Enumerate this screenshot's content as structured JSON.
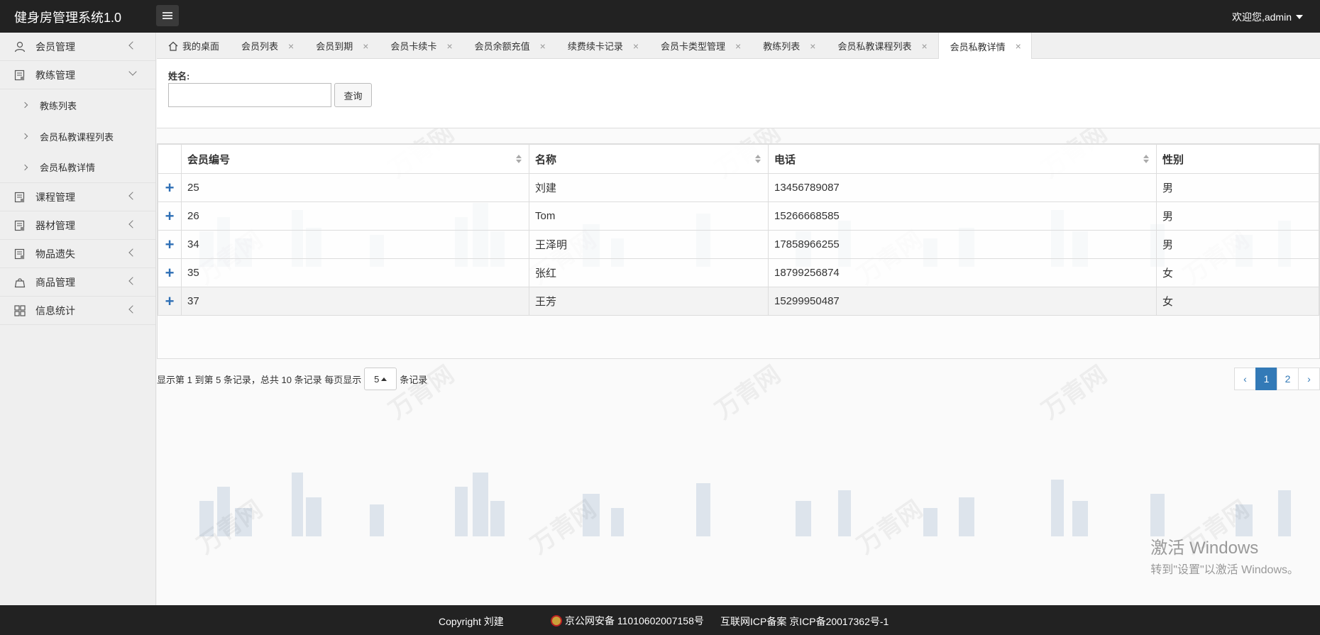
{
  "header": {
    "app_title": "健身房管理系统1.0",
    "user_menu": "欢迎您,admin"
  },
  "sidebar": {
    "items": [
      {
        "label": "会员管理",
        "icon": "user-icon"
      },
      {
        "label": "教练管理",
        "icon": "document-icon",
        "expanded": true,
        "children": [
          "教练列表",
          "会员私教课程列表",
          "会员私教详情"
        ]
      },
      {
        "label": "课程管理",
        "icon": "document-icon"
      },
      {
        "label": "器材管理",
        "icon": "document-icon"
      },
      {
        "label": "物品遗失",
        "icon": "document-icon"
      },
      {
        "label": "商品管理",
        "icon": "bag-icon"
      },
      {
        "label": "信息统计",
        "icon": "grid-icon"
      }
    ]
  },
  "tabs": [
    {
      "label": "我的桌面",
      "closable": false
    },
    {
      "label": "会员列表",
      "closable": true
    },
    {
      "label": "会员到期",
      "closable": true
    },
    {
      "label": "会员卡续卡",
      "closable": true
    },
    {
      "label": "会员余额充值",
      "closable": true
    },
    {
      "label": "续费续卡记录",
      "closable": true
    },
    {
      "label": "会员卡类型管理",
      "closable": true
    },
    {
      "label": "教练列表",
      "closable": true
    },
    {
      "label": "会员私教课程列表",
      "closable": true
    },
    {
      "label": "会员私教详情",
      "closable": true,
      "active": true
    }
  ],
  "search": {
    "name_label": "姓名:",
    "name_value": "",
    "query_label": "查询"
  },
  "table": {
    "columns": [
      "会员编号",
      "名称",
      "电话",
      "性别"
    ],
    "rows": [
      [
        "25",
        "刘建",
        "13456789087",
        "男"
      ],
      [
        "26",
        "Tom",
        "15266668585",
        "男"
      ],
      [
        "34",
        "王泽明",
        "17858966255",
        "男"
      ],
      [
        "35",
        "张红",
        "18799256874",
        "女"
      ],
      [
        "37",
        "王芳",
        "15299950487",
        "女"
      ]
    ],
    "expand_symbol": "+"
  },
  "pagination": {
    "info_prefix": "显示第 1 到第 5 条记录，总共 10 条记录 每页显示",
    "page_size": "5",
    "info_suffix": "条记录",
    "prev": "‹",
    "pages": [
      "1",
      "2"
    ],
    "next": "›",
    "current_page": "1"
  },
  "watermark": {
    "text": "万青网",
    "activate_title": "激活 Windows",
    "activate_sub": "转到\"设置\"以激活 Windows。"
  },
  "footer": {
    "copyright": "Copyright 刘建",
    "police": "京公网安备 11010602007158号",
    "icp": "互联网ICP备案 京ICP备20017362号-1"
  },
  "colors": {
    "header_bg": "#222222",
    "accent": "#337ab7",
    "expand_icon": "#2e6fb5"
  }
}
